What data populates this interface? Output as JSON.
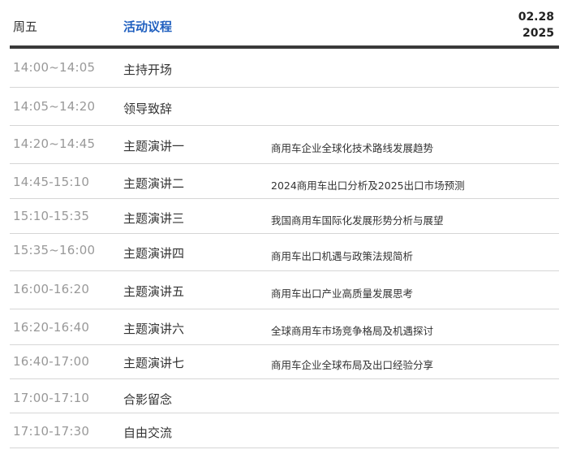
{
  "header": {
    "day": "周五",
    "title": "活动议程",
    "date_day": "02.28",
    "date_year": "2025"
  },
  "rows": [
    {
      "time": "14:00~14:05",
      "session": "主持开场",
      "topic": ""
    },
    {
      "time": "14:05~14:20",
      "session": "领导致辞",
      "topic": ""
    },
    {
      "time": "14:20~14:45",
      "session": "主题演讲一",
      "topic": "商用车企业全球化技术路线发展趋势"
    },
    {
      "time": "14:45-15:10",
      "session": "主题演讲二",
      "topic": "2024商用车出口分析及2025出口市场预测"
    },
    {
      "time": "15:10-15:35",
      "session": "主题演讲三",
      "topic": "我国商用车国际化发展形势分析与展望"
    },
    {
      "time": "15:35~16:00",
      "session": "主题演讲四",
      "topic": "商用车出口机遇与政策法规简析"
    },
    {
      "time": "16:00-16:20",
      "session": "主题演讲五",
      "topic": "商用车出口产业高质量发展思考"
    },
    {
      "time": "16:20-16:40",
      "session": "主题演讲六",
      "topic": "全球商用车市场竞争格局及机遇探讨"
    },
    {
      "time": "16:40-17:00",
      "session": "主题演讲七",
      "topic": "商用车企业全球布局及出口经验分享"
    },
    {
      "time": "17:00-17:10",
      "session": "合影留念",
      "topic": ""
    },
    {
      "time": "17:10-17:30",
      "session": "自由交流",
      "topic": ""
    }
  ]
}
